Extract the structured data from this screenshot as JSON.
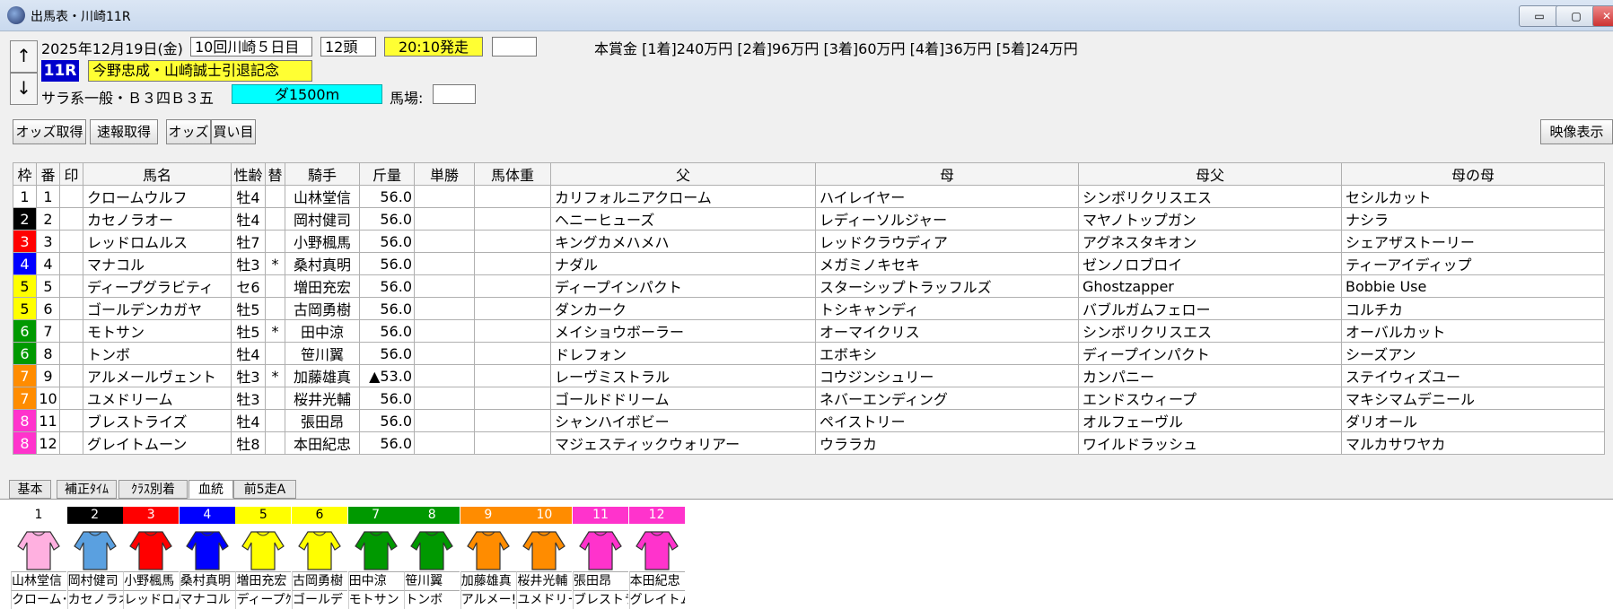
{
  "window": {
    "title": "出馬表・川崎11R",
    "min": "▭",
    "max": "▢",
    "close": "✕"
  },
  "header": {
    "up": "↑",
    "down": "↓",
    "date": "2025年12月19日(金)",
    "meeting": "10回川崎５日目",
    "count": "12頭",
    "post_time": "20:10発走",
    "blank": "",
    "prize": "本賞金 [1着]240万円 [2着]96万円 [3着]60万円 [4着]36万円 [5着]24万円",
    "race_no": "11R",
    "race_name": "今野忠成・山崎誠士引退記念",
    "class": "サラ系一般・Ｂ３四Ｂ３五",
    "course": "ダ1500m",
    "baba_label": "馬場:",
    "baba_value": ""
  },
  "toolbar": {
    "odds_get": "オッズ取得",
    "flash_get": "速報取得",
    "odds": "オッズ",
    "kaime": "買い目",
    "video": "映像表示"
  },
  "table": {
    "columns": [
      "枠",
      "番",
      "印",
      "馬名",
      "性齢",
      "替",
      "騎手",
      "斤量",
      "単勝",
      "馬体重",
      "父",
      "母",
      "母父",
      "母の母"
    ],
    "rows": [
      {
        "waku": "1",
        "ban": "1",
        "mark": "",
        "name": "クロームウルフ",
        "sexage": "牡4",
        "kae": "",
        "jockey": "山林堂信",
        "kin": "56.0",
        "tan": "",
        "weight": "",
        "sire": "カリフォルニアクローム",
        "dam": "ハイレイヤー",
        "bms": "シンボリクリスエス",
        "ggdam": "セシルカット"
      },
      {
        "waku": "2",
        "ban": "2",
        "mark": "",
        "name": "カセノラオー",
        "sexage": "牡4",
        "kae": "",
        "jockey": "岡村健司",
        "kin": "56.0",
        "tan": "",
        "weight": "",
        "sire": "ヘニーヒューズ",
        "dam": "レディーソルジャー",
        "bms": "マヤノトップガン",
        "ggdam": "ナシラ"
      },
      {
        "waku": "3",
        "ban": "3",
        "mark": "",
        "name": "レッドロムルス",
        "sexage": "牡7",
        "kae": "",
        "jockey": "小野楓馬",
        "kin": "56.0",
        "tan": "",
        "weight": "",
        "sire": "キングカメハメハ",
        "dam": "レッドクラウディア",
        "bms": "アグネスタキオン",
        "ggdam": "シェアザストーリー"
      },
      {
        "waku": "4",
        "ban": "4",
        "mark": "",
        "name": "マナコル",
        "sexage": "牡3",
        "kae": "*",
        "jockey": "桑村真明",
        "kin": "56.0",
        "tan": "",
        "weight": "",
        "sire": "ナダル",
        "dam": "メガミノキセキ",
        "bms": "ゼンノロブロイ",
        "ggdam": "ティーアイディップ"
      },
      {
        "waku": "5",
        "ban": "5",
        "mark": "",
        "name": "ディープグラビティ",
        "sexage": "セ6",
        "kae": "",
        "jockey": "増田充宏",
        "kin": "56.0",
        "tan": "",
        "weight": "",
        "sire": "ディープインパクト",
        "dam": "スターシップトラッフルズ",
        "bms": "Ghostzapper",
        "ggdam": "Bobbie Use"
      },
      {
        "waku": "5",
        "ban": "6",
        "mark": "",
        "name": "ゴールデンカガヤ",
        "sexage": "牡5",
        "kae": "",
        "jockey": "古岡勇樹",
        "kin": "56.0",
        "tan": "",
        "weight": "",
        "sire": "ダンカーク",
        "dam": "トシキャンディ",
        "bms": "バブルガムフェロー",
        "ggdam": "コルチカ"
      },
      {
        "waku": "6",
        "ban": "7",
        "mark": "",
        "name": "モトサン",
        "sexage": "牡5",
        "kae": "*",
        "jockey": "田中涼",
        "kin": "56.0",
        "tan": "",
        "weight": "",
        "sire": "メイショウボーラー",
        "dam": "オーマイクリス",
        "bms": "シンボリクリスエス",
        "ggdam": "オーバルカット"
      },
      {
        "waku": "6",
        "ban": "8",
        "mark": "",
        "name": "トンボ",
        "sexage": "牡4",
        "kae": "",
        "jockey": "笹川翼",
        "kin": "56.0",
        "tan": "",
        "weight": "",
        "sire": "ドレフォン",
        "dam": "エボキシ",
        "bms": "ディープインパクト",
        "ggdam": "シーズアン"
      },
      {
        "waku": "7",
        "ban": "9",
        "mark": "",
        "name": "アルメールヴェント",
        "sexage": "牡3",
        "kae": "*",
        "jockey": "加藤雄真",
        "kin": "▲53.0",
        "tan": "",
        "weight": "",
        "sire": "レーヴミストラル",
        "dam": "コウジンシュリー",
        "bms": "カンパニー",
        "ggdam": "ステイウィズユー"
      },
      {
        "waku": "7",
        "ban": "10",
        "mark": "",
        "name": "ユメドリーム",
        "sexage": "牡3",
        "kae": "",
        "jockey": "桜井光輔",
        "kin": "56.0",
        "tan": "",
        "weight": "",
        "sire": "ゴールドドリーム",
        "dam": "ネバーエンディング",
        "bms": "エンドスウィープ",
        "ggdam": "マキシマムデニール"
      },
      {
        "waku": "8",
        "ban": "11",
        "mark": "",
        "name": "ブレストライズ",
        "sexage": "牡4",
        "kae": "",
        "jockey": "張田昂",
        "kin": "56.0",
        "tan": "",
        "weight": "",
        "sire": "シャンハイボビー",
        "dam": "ペイストリー",
        "bms": "オルフェーヴル",
        "ggdam": "ダリオール"
      },
      {
        "waku": "8",
        "ban": "12",
        "mark": "",
        "name": "グレイトムーン",
        "sexage": "牡8",
        "kae": "",
        "jockey": "本田紀忠",
        "kin": "56.0",
        "tan": "",
        "weight": "",
        "sire": "マジェスティックウォリアー",
        "dam": "ウララカ",
        "bms": "ワイルドラッシュ",
        "ggdam": "マルカサワヤカ"
      }
    ]
  },
  "tabs": [
    "基本",
    "補正ﾀｲﾑ",
    "ｸﾗｽ別着",
    "血統",
    "前5走A"
  ],
  "active_tab": "血統",
  "silks": [
    {
      "num": "1",
      "jockey": "山林堂信",
      "horse": "クローム･"
    },
    {
      "num": "2",
      "jockey": "岡村健司",
      "horse": "カセノラオ"
    },
    {
      "num": "3",
      "jockey": "小野楓馬",
      "horse": "レッドロム"
    },
    {
      "num": "4",
      "jockey": "桑村真明",
      "horse": "マナコル"
    },
    {
      "num": "5",
      "jockey": "増田充宏",
      "horse": "ディープｸﾞ"
    },
    {
      "num": "6",
      "jockey": "古岡勇樹",
      "horse": "ゴールデ"
    },
    {
      "num": "7",
      "jockey": "田中涼",
      "horse": "モトサン"
    },
    {
      "num": "8",
      "jockey": "笹川翼",
      "horse": "トンボ"
    },
    {
      "num": "9",
      "jockey": "加藤雄真",
      "horse": "アルメー!"
    },
    {
      "num": "10",
      "jockey": "桜井光輔",
      "horse": "ユメドリー"
    },
    {
      "num": "11",
      "jockey": "張田昂",
      "horse": "ブレストラ"
    },
    {
      "num": "12",
      "jockey": "本田紀忠",
      "horse": "グレイトム"
    }
  ],
  "colors": {
    "waku": {
      "1": [
        "#ffffff",
        "#000000"
      ],
      "2": [
        "#000000",
        "#ffffff"
      ],
      "3": [
        "#ff0000",
        "#ffffff"
      ],
      "4": [
        "#0000ff",
        "#ffffff"
      ],
      "5": [
        "#ffff00",
        "#000000"
      ],
      "6": [
        "#009900",
        "#ffffff"
      ],
      "7": [
        "#ff8c00",
        "#ffffff"
      ],
      "8": [
        "#ff33cc",
        "#ffffff"
      ]
    },
    "post_time_bg": "#ffff33",
    "race_no_bg": "#0000cc",
    "race_name_bg": "#ffff33",
    "course_bg": "#00ffff"
  }
}
